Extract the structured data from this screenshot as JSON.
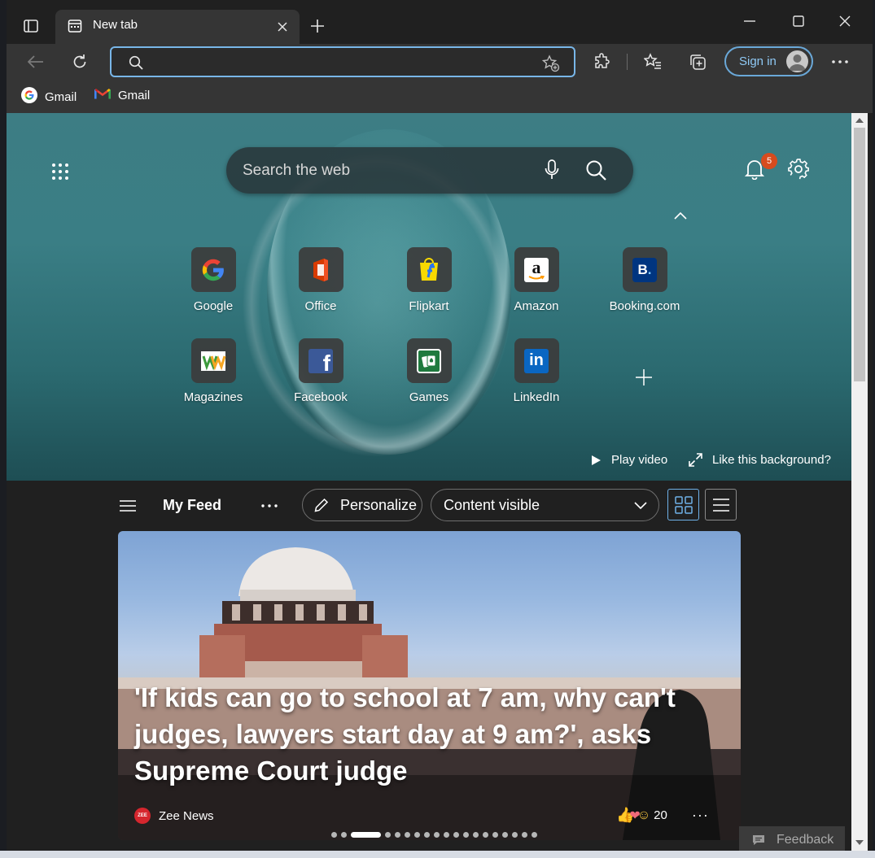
{
  "browser": {
    "tab_title": "New tab",
    "address_value": "",
    "signin_label": "Sign in",
    "bookmarks": [
      {
        "label": "Gmail",
        "icon": "google-icon"
      },
      {
        "label": "Gmail",
        "icon": "gmail-icon"
      }
    ]
  },
  "hero": {
    "search_placeholder": "Search the web",
    "notification_count": "5",
    "tiles": [
      {
        "label": "Google",
        "icon": "google-icon"
      },
      {
        "label": "Office",
        "icon": "office-icon"
      },
      {
        "label": "Flipkart",
        "icon": "flipkart-icon"
      },
      {
        "label": "Amazon",
        "icon": "amazon-icon"
      },
      {
        "label": "Booking.com",
        "icon": "booking-icon"
      },
      {
        "label": "Magazines",
        "icon": "magazines-icon"
      },
      {
        "label": "Facebook",
        "icon": "facebook-icon"
      },
      {
        "label": "Games",
        "icon": "games-icon"
      },
      {
        "label": "LinkedIn",
        "icon": "linkedin-icon"
      }
    ],
    "play_video": "Play video",
    "like_background": "Like this background?"
  },
  "feed": {
    "title": "My Feed",
    "personalize": "Personalize",
    "content_visible": "Content visible"
  },
  "article": {
    "headline": "'If kids can go to school at 7 am, why can't judges, lawyers start day at 9 am?', asks Supreme Court judge",
    "source": "Zee News",
    "source_badge": "ZEE",
    "reaction_count": "20",
    "carousel_count": 19,
    "carousel_active": 2
  },
  "feedback": "Feedback",
  "colors": {
    "accent": "#78b6e8",
    "badge": "#d64b1e"
  }
}
